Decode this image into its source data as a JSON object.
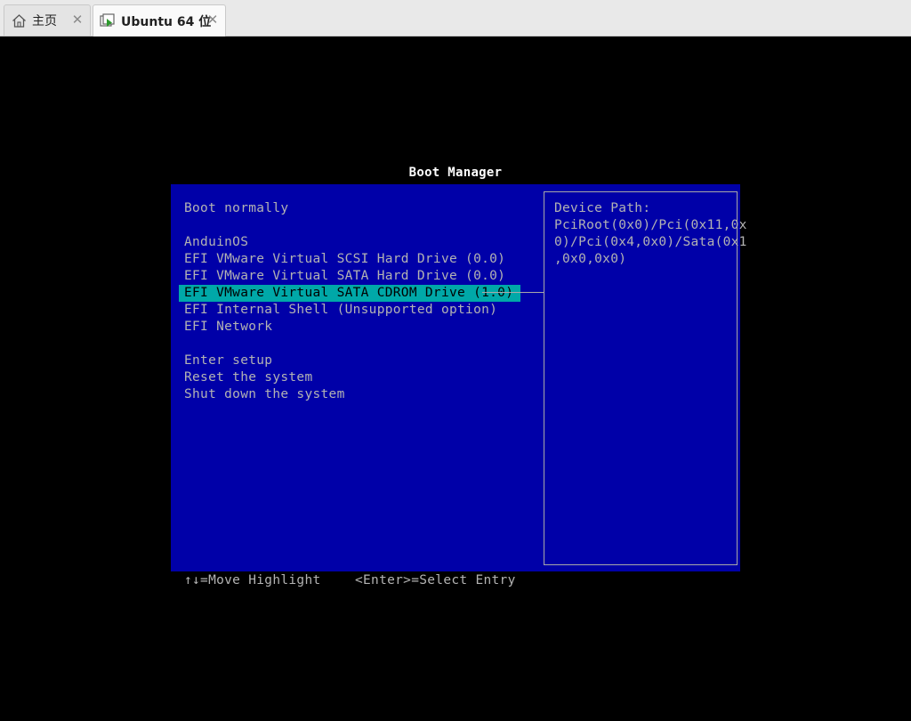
{
  "tabs": [
    {
      "label": "主页",
      "icon": "home-icon"
    },
    {
      "label": "Ubuntu 64 位",
      "icon": "vm-icon"
    }
  ],
  "boot_manager": {
    "title": "Boot Manager",
    "items": [
      "Boot normally",
      "AnduinOS",
      "EFI VMware Virtual SCSI Hard Drive (0.0)",
      "EFI VMware Virtual SATA Hard Drive (0.0)",
      "EFI VMware Virtual SATA CDROM Drive (1.0)",
      "EFI Internal Shell (Unsupported option)",
      "EFI Network",
      "Enter setup",
      "Reset the system",
      "Shut down the system"
    ],
    "selected_index": 4,
    "device_path_label": "Device Path:",
    "device_path_lines": [
      "PciRoot(0x0)/Pci(0x11,0x",
      "0)/Pci(0x4,0x0)/Sata(0x1",
      ",0x0,0x0)"
    ],
    "footer": {
      "move_hint": "↑↓=Move Highlight",
      "select_hint": "<Enter>=Select Entry"
    }
  },
  "colors": {
    "panel_bg": "#0000a8",
    "highlight_bg": "#00a8a8",
    "text": "#b3b3b3",
    "title_text": "#ffffff"
  }
}
